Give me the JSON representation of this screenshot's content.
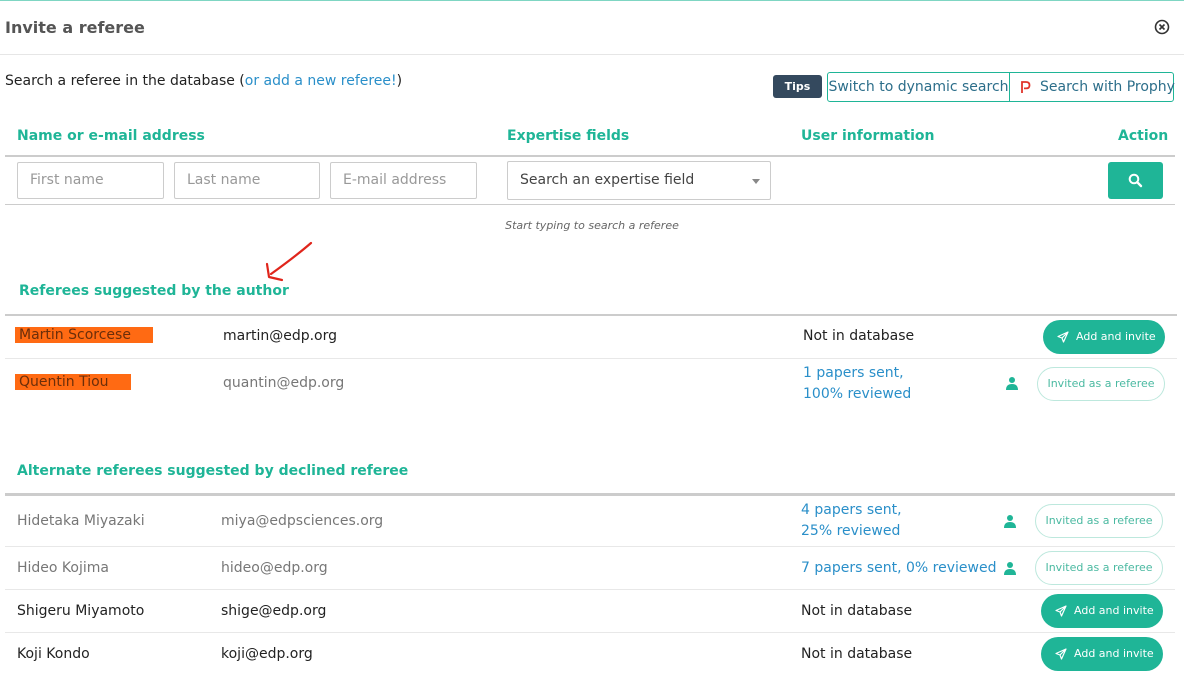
{
  "modal": {
    "title": "Invite a referee",
    "close_icon": "close-circle-icon"
  },
  "intro": {
    "text_before": "Search a referee in the database (",
    "link": "or add a new referee!",
    "text_after": ")"
  },
  "toolbar": {
    "tips": "Tips",
    "dynamic_search": "Switch to dynamic search",
    "prophy": "Search with Prophy",
    "prophy_icon": "prophy-logo-icon"
  },
  "columns": {
    "name": "Name or e-mail address",
    "expertise": "Expertise fields",
    "user_info": "User information",
    "action": "Action"
  },
  "search": {
    "first_name_placeholder": "First name",
    "last_name_placeholder": "Last name",
    "email_placeholder": "E-mail address",
    "expertise_select": "Search an expertise field",
    "hint": "Start typing to search a referee"
  },
  "suggested": {
    "title": "Referees suggested by the author",
    "rows": [
      {
        "name": "Martin Scorcese",
        "email": "martin@edp.org",
        "info": "Not in database",
        "action": "Add and invite"
      },
      {
        "name": "Quentin Tiou",
        "email": "quantin@edp.org",
        "info_line1": "1 papers sent,",
        "info_line2": "100% reviewed",
        "action": "Invited as a referee"
      }
    ]
  },
  "alternates": {
    "title": "Alternate referees suggested by declined referee",
    "rows": [
      {
        "name": "Hidetaka Miyazaki",
        "email": "miya@edpsciences.org",
        "info_line1": "4 papers sent,",
        "info_line2": "25% reviewed",
        "action": "Invited as a referee"
      },
      {
        "name": "Hideo Kojima",
        "email": "hideo@edp.org",
        "info": "7 papers sent, 0% reviewed",
        "action": "Invited as a referee"
      },
      {
        "name": "Shigeru Miyamoto",
        "email": "shige@edp.org",
        "info": "Not in database",
        "action": "Add and invite"
      },
      {
        "name": "Koji Kondo",
        "email": "koji@edp.org",
        "info": "Not in database",
        "action": "Add and invite"
      }
    ]
  },
  "colors": {
    "accent": "#1fb597",
    "link": "#2a8fc9",
    "highlight": "#ff6a13",
    "annotation": "#e0251b"
  }
}
